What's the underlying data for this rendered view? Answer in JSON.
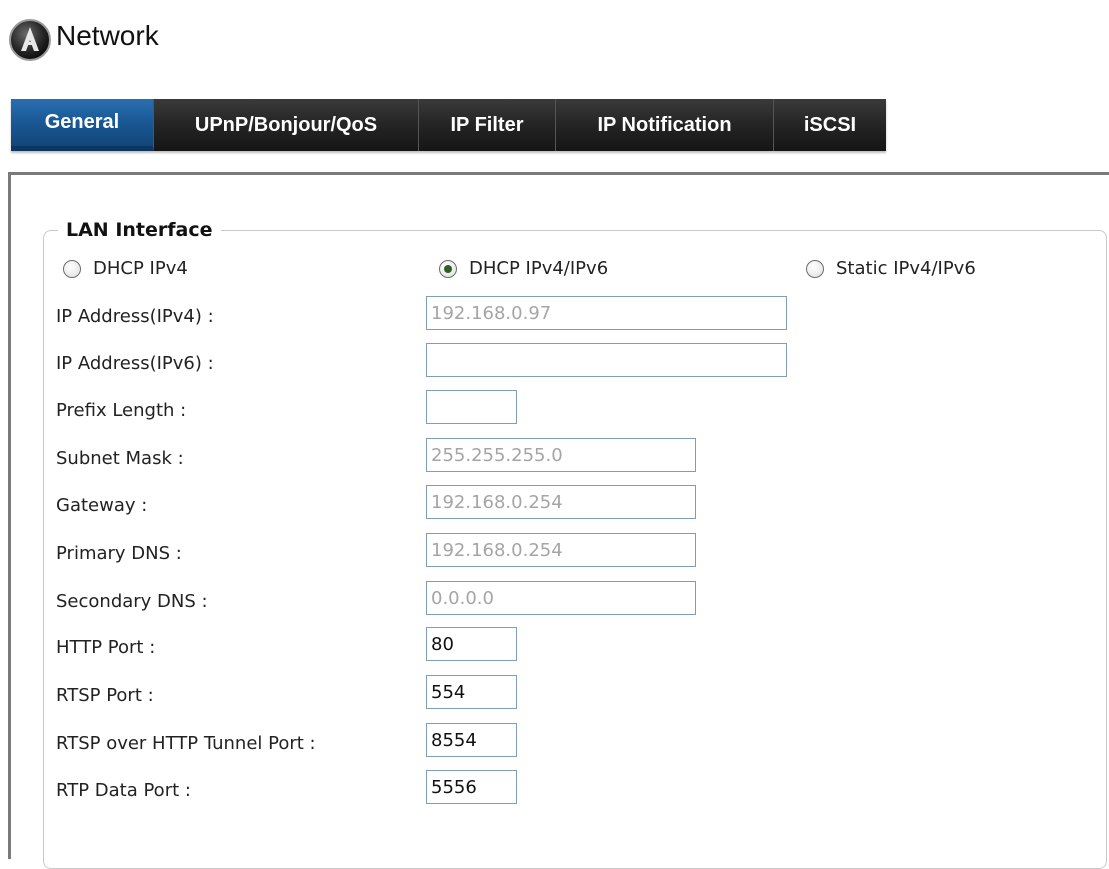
{
  "header": {
    "title": "Network",
    "logo_icon": "network-logo-icon"
  },
  "tabs": [
    {
      "label": "General",
      "active": true
    },
    {
      "label": "UPnP/Bonjour/QoS",
      "active": false
    },
    {
      "label": "IP Filter",
      "active": false
    },
    {
      "label": "IP Notification",
      "active": false
    },
    {
      "label": "iSCSI",
      "active": false
    }
  ],
  "lan": {
    "legend": "LAN Interface",
    "modes": [
      {
        "label": "DHCP IPv4",
        "selected": false
      },
      {
        "label": "DHCP IPv4/IPv6",
        "selected": true
      },
      {
        "label": "Static IPv4/IPv6",
        "selected": false
      }
    ],
    "fields": {
      "ipv4": {
        "label": "IP Address(IPv4) :",
        "value": "192.168.0.97"
      },
      "ipv6": {
        "label": "IP Address(IPv6) :",
        "value": ""
      },
      "prefix": {
        "label": "Prefix Length :",
        "value": ""
      },
      "subnet": {
        "label": "Subnet Mask :",
        "value": "255.255.255.0"
      },
      "gateway": {
        "label": "Gateway :",
        "value": "192.168.0.254"
      },
      "dns1": {
        "label": "Primary DNS :",
        "value": "192.168.0.254"
      },
      "dns2": {
        "label": "Secondary DNS :",
        "value": "0.0.0.0"
      },
      "http_port": {
        "label": "HTTP Port :",
        "value": "80"
      },
      "rtsp_port": {
        "label": "RTSP Port :",
        "value": "554"
      },
      "rtsp_http_port": {
        "label": "RTSP over HTTP Tunnel Port :",
        "value": "8554"
      },
      "rtp_port": {
        "label": "RTP Data Port :",
        "value": "5556"
      }
    }
  },
  "colors": {
    "tab_active": "#1a5794",
    "tab_bar": "#262626",
    "input_border": "#7f9db9",
    "disabled_text": "#a5a5a5"
  }
}
